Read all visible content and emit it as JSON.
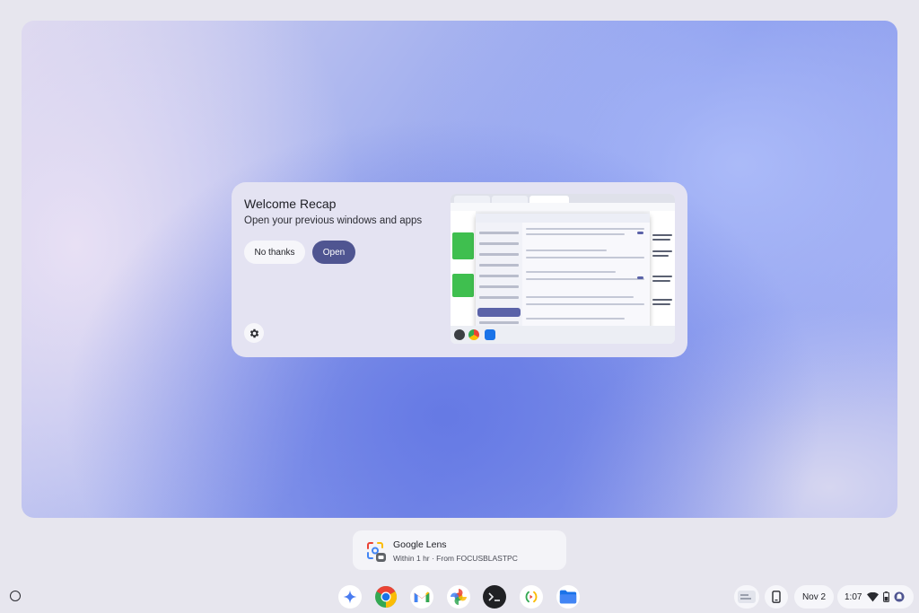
{
  "recap": {
    "title": "Welcome Recap",
    "subtitle": "Open your previous windows and apps",
    "no_thanks_label": "No thanks",
    "open_label": "Open",
    "settings_icon": "gear-icon"
  },
  "notification": {
    "title": "Google Lens",
    "subtitle": "Within 1 hr · From FOCUSBLASTPC",
    "icon": "google-lens-icon"
  },
  "shelf": {
    "launcher_icon": "launcher-icon",
    "apps": [
      {
        "name": "Gemini",
        "icon": "gemini-icon"
      },
      {
        "name": "Chrome",
        "icon": "chrome-icon"
      },
      {
        "name": "Gmail",
        "icon": "gmail-icon"
      },
      {
        "name": "Google Photos",
        "icon": "photos-icon"
      },
      {
        "name": "Terminal",
        "icon": "terminal-icon"
      },
      {
        "name": "Phone Hub",
        "icon": "phone-hub-icon"
      },
      {
        "name": "Files",
        "icon": "files-icon"
      }
    ]
  },
  "tray": {
    "date": "Nov 2",
    "time": "1:07",
    "icons": [
      "wifi-icon",
      "battery-icon",
      "do-not-disturb-icon"
    ]
  },
  "colors": {
    "accent": "#4f5591",
    "card_background": "#e4e3f2",
    "shelf_background": "#e7e6ee"
  }
}
